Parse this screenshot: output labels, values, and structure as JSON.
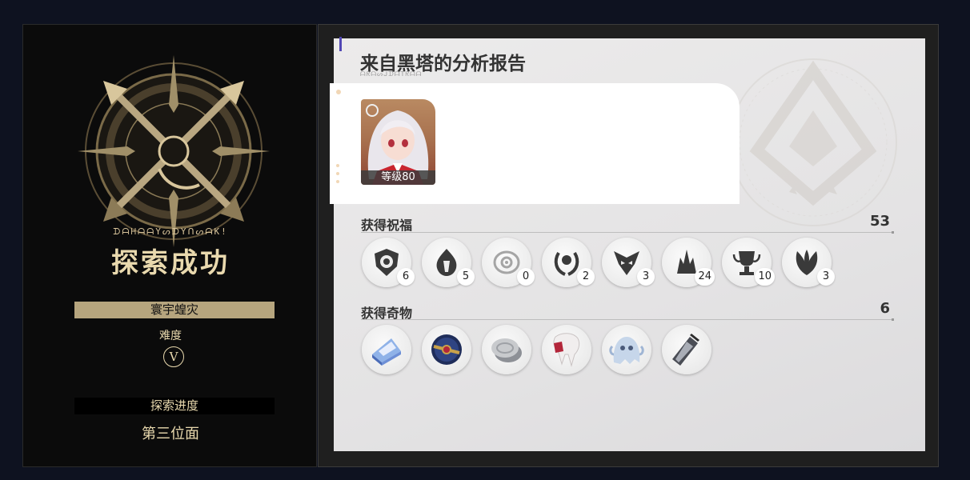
{
  "result": {
    "subtitle": "ᗪᗩᕼᗩᗩYᔕᗪYᑎᔕᗩK!",
    "title": "探索成功",
    "mode": "寰宇蝗灾",
    "difficulty_label": "难度",
    "difficulty_value": "Ⅴ",
    "progress_label": "探索进度",
    "progress_value": "第三位面"
  },
  "report": {
    "title": "来自黑塔的分析报告",
    "character": {
      "level_label": "等级80"
    }
  },
  "blessings": {
    "label": "获得祝福",
    "total": "53",
    "items": [
      {
        "icon": "preservation-shield-icon",
        "count": "6",
        "color": "#3a3a3a"
      },
      {
        "icon": "destruction-flame-icon",
        "count": "5",
        "color": "#3a3a3a"
      },
      {
        "icon": "nihility-eye-icon",
        "count": "0",
        "color": "#9a9a9a"
      },
      {
        "icon": "elation-laurel-icon",
        "count": "2",
        "color": "#3a3a3a"
      },
      {
        "icon": "remembrance-mask-icon",
        "count": "3",
        "color": "#3a3a3a"
      },
      {
        "icon": "propagation-swarm-icon",
        "count": "24",
        "color": "#3a3a3a"
      },
      {
        "icon": "erudition-trophy-icon",
        "count": "10",
        "color": "#3a3a3a"
      },
      {
        "icon": "abundance-leaf-icon",
        "count": "3",
        "color": "#3a3a3a"
      }
    ]
  },
  "curios": {
    "label": "获得奇物",
    "total": "6",
    "items": [
      {
        "icon": "crystal-cake-icon"
      },
      {
        "icon": "ornate-orb-icon"
      },
      {
        "icon": "silver-coin-icon"
      },
      {
        "icon": "fang-tooth-icon"
      },
      {
        "icon": "ghost-creature-icon"
      },
      {
        "icon": "paint-tube-icon"
      }
    ]
  },
  "colors": {
    "gold": "#e9d9ae",
    "accent": "#5248b5",
    "paper": "#e8e7e8"
  }
}
